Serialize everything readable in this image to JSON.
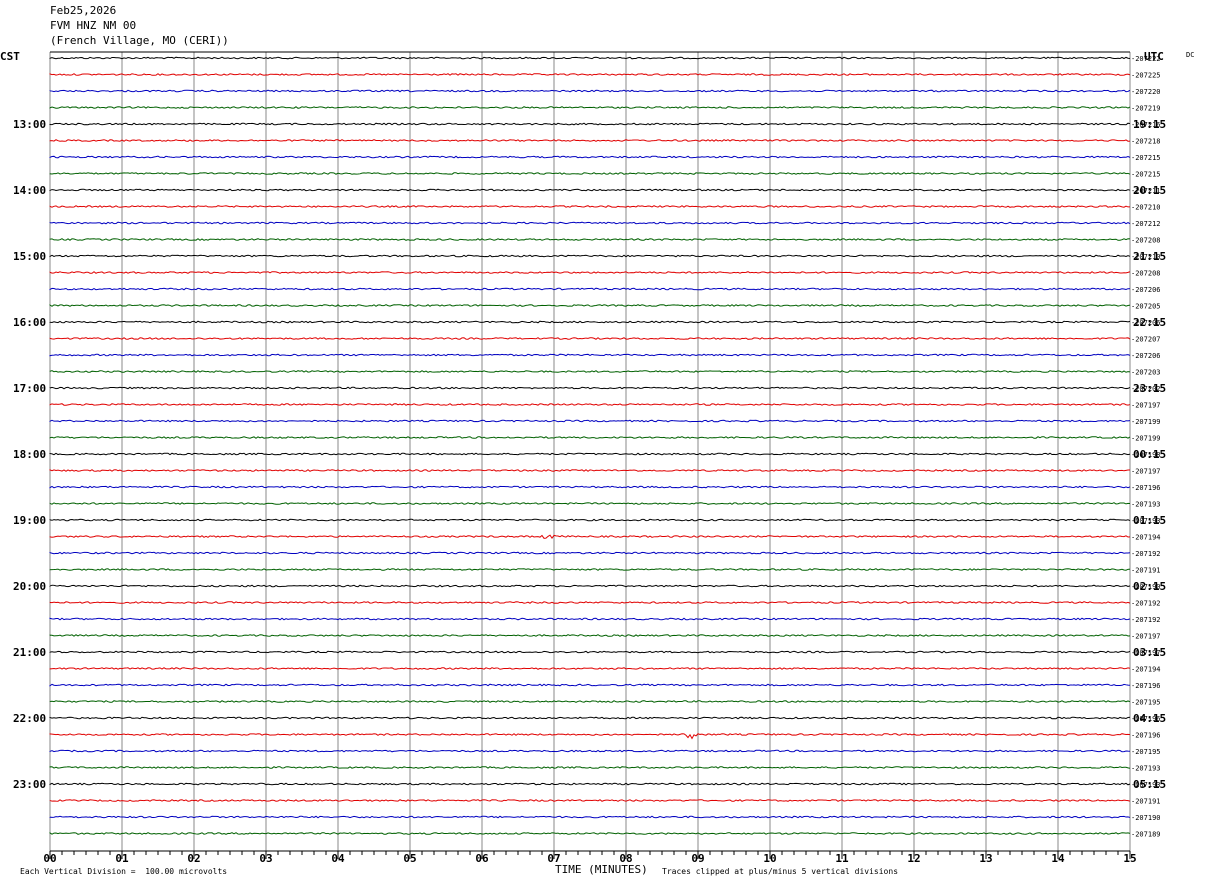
{
  "header": {
    "date": "Feb25,2026",
    "station": "FVM HNZ NM 00",
    "location": "(French Village, MO (CERI))"
  },
  "left_zone_label": "CST",
  "right_zone_label": "UTC",
  "right_corner_label": "DC",
  "footer": {
    "scale_note": "Each Vertical Division =  100.00 microvolts",
    "clip_note": "Traces clipped at plus/minus 5 vertical divisions"
  },
  "chart_data": {
    "type": "line",
    "title": "",
    "xlabel": "TIME (MINUTES)",
    "ylabel": "",
    "xlim": [
      0,
      15
    ],
    "x_tick_labels": [
      "00",
      "01",
      "02",
      "03",
      "04",
      "05",
      "06",
      "07",
      "08",
      "09",
      "10",
      "11",
      "12",
      "13",
      "14",
      "15"
    ],
    "grid": true,
    "trace_colors": [
      "#000000",
      "#e00000",
      "#0000c0",
      "#006000"
    ],
    "left_hour_labels": [
      "13:00",
      "14:00",
      "15:00",
      "16:00",
      "17:00",
      "18:00",
      "19:00",
      "20:00",
      "21:00",
      "22:00",
      "23:00"
    ],
    "right_hour_labels": [
      "19:15",
      "20:15",
      "21:15",
      "22:15",
      "23:15",
      "00:15",
      "01:15",
      "02:15",
      "03:15",
      "04:15",
      "05:15"
    ],
    "dc_offsets": [
      "-207222",
      "-207225",
      "-207220",
      "-207219",
      "-207216",
      "-207218",
      "-207215",
      "-207215",
      "-207211",
      "-207210",
      "-207212",
      "-207208",
      "-207210",
      "-207208",
      "-207206",
      "-207205",
      "-207206",
      "-207207",
      "-207206",
      "-207203",
      "-207202",
      "-207197",
      "-207199",
      "-207199",
      "-207198",
      "-207197",
      "-207196",
      "-207193",
      "-207193",
      "-207194",
      "-207192",
      "-207191",
      "-207190",
      "-207192",
      "-207192",
      "-207197",
      "-207197",
      "-207194",
      "-207196",
      "-207195",
      "-207196",
      "-207196",
      "-207195",
      "-207193",
      "-207193",
      "-207191",
      "-207190",
      "-207189"
    ],
    "events": [
      {
        "trace": 29,
        "minute": 6.95,
        "amplitude": 3
      },
      {
        "trace": 41,
        "minute": 8.9,
        "amplitude": 4
      }
    ]
  }
}
